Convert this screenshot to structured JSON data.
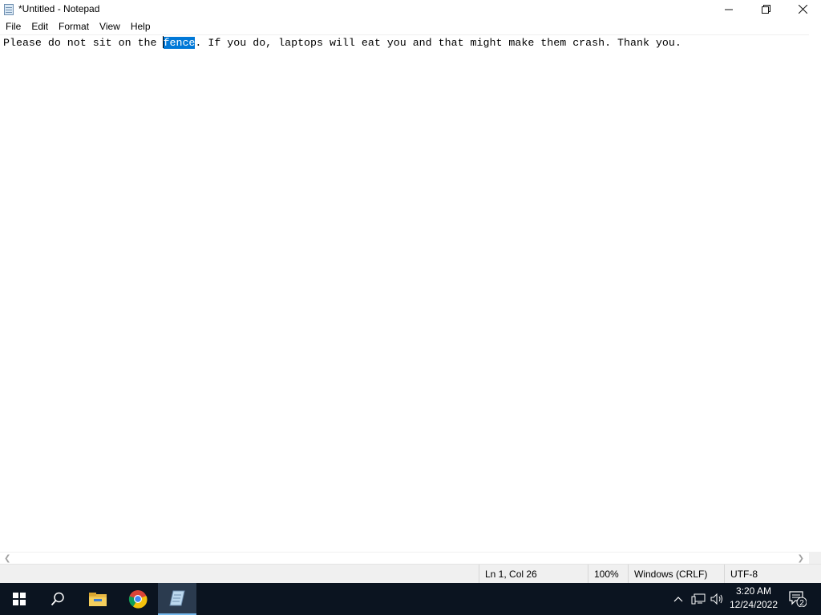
{
  "window": {
    "title": "*Untitled - Notepad",
    "minimize_glyph": "—",
    "maximize_glyph": "❐",
    "close_glyph": "✕"
  },
  "menu": {
    "items": [
      "File",
      "Edit",
      "Format",
      "View",
      "Help"
    ]
  },
  "editor": {
    "text_before": "Please do not sit on the ",
    "selected_text": "fence",
    "text_after": ". If you do, laptops will eat you and that might make them crash. Thank you."
  },
  "statusbar": {
    "position": "Ln 1, Col 26",
    "zoom": "100%",
    "line_ending": "Windows (CRLF)",
    "encoding": "UTF-8"
  },
  "taskbar": {
    "time": "3:20 AM",
    "date": "12/24/2022",
    "notification_count": "2",
    "apps": [
      "start-icon",
      "search-icon",
      "file-explorer-icon",
      "chrome-icon",
      "notepad-icon"
    ]
  },
  "colors": {
    "selection": "#0078d7",
    "taskbar": "#0b1420",
    "statusbar": "#f0f0f0"
  }
}
